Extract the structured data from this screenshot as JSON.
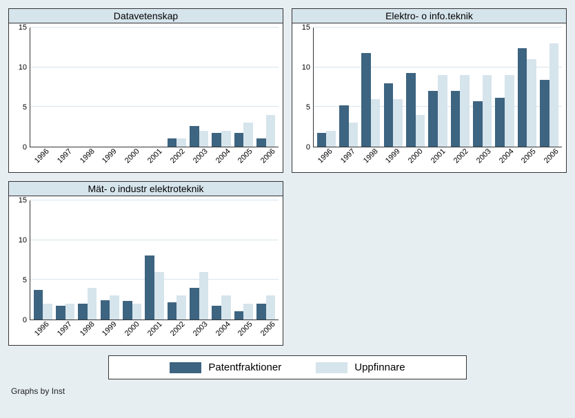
{
  "chart_data": [
    {
      "type": "bar",
      "title": "Datavetenskap",
      "categories": [
        "1996",
        "1997",
        "1998",
        "1999",
        "2000",
        "2001",
        "2002",
        "2003",
        "2004",
        "2005",
        "2006"
      ],
      "series": [
        {
          "name": "Patentfraktioner",
          "values": [
            0,
            0,
            0,
            0,
            0,
            0,
            1,
            2.6,
            1.7,
            1.7,
            1
          ]
        },
        {
          "name": "Uppfinnare",
          "values": [
            0,
            0,
            0,
            0,
            0,
            0,
            1,
            2,
            2,
            3,
            4
          ]
        }
      ],
      "ylim": [
        0,
        15
      ],
      "yticks": [
        0,
        5,
        10,
        15
      ]
    },
    {
      "type": "bar",
      "title": "Elektro- o info.teknik",
      "categories": [
        "1996",
        "1997",
        "1998",
        "1999",
        "2000",
        "2001",
        "2002",
        "2003",
        "2004",
        "2005",
        "2006"
      ],
      "series": [
        {
          "name": "Patentfraktioner",
          "values": [
            1.7,
            5.2,
            11.8,
            8,
            9.3,
            7,
            7,
            5.7,
            6.2,
            12.4,
            8.4
          ]
        },
        {
          "name": "Uppfinnare",
          "values": [
            2,
            3,
            6,
            6,
            4,
            9,
            9,
            9,
            9,
            11,
            13
          ]
        }
      ],
      "ylim": [
        0,
        15
      ],
      "yticks": [
        0,
        5,
        10,
        15
      ]
    },
    {
      "type": "bar",
      "title": "Mät- o industr elektroteknik",
      "categories": [
        "1996",
        "1997",
        "1998",
        "1999",
        "2000",
        "2001",
        "2002",
        "2003",
        "2004",
        "2005",
        "2006"
      ],
      "series": [
        {
          "name": "Patentfraktioner",
          "values": [
            3.7,
            1.7,
            2,
            2.4,
            2.3,
            8.1,
            2.2,
            4,
            1.7,
            1,
            2
          ]
        },
        {
          "name": "Uppfinnare",
          "values": [
            2,
            2,
            4,
            3,
            2,
            6,
            3,
            6,
            3,
            2,
            3
          ]
        }
      ],
      "ylim": [
        0,
        15
      ],
      "yticks": [
        0,
        5,
        10,
        15
      ]
    }
  ],
  "legend": {
    "s1": "Patentfraktioner",
    "s2": "Uppfinnare"
  },
  "footer": "Graphs by Inst"
}
